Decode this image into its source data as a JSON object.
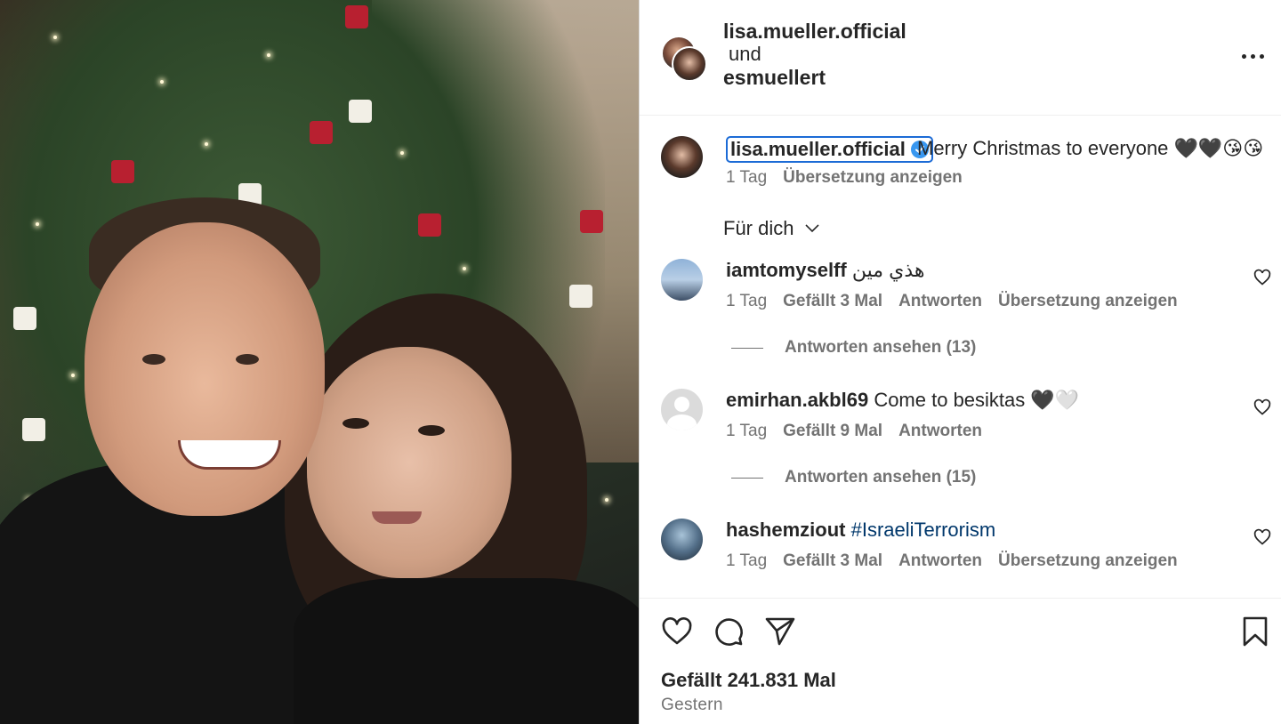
{
  "post_header": {
    "author": "lisa.mueller.official",
    "conjunction": "und",
    "collaborator": "esmuellert",
    "more_icon": "more-horizontal-icon"
  },
  "caption": {
    "username": "lisa.mueller.official",
    "verified_icon": "verified-badge-icon",
    "text": "Merry Christmas to everyone 🖤🖤😘😘",
    "age": "1 Tag",
    "translate": "Übersetzung anzeigen"
  },
  "sort": {
    "label": "Für dich",
    "icon": "chevron-down-icon"
  },
  "comments": [
    {
      "username": "iamtomyselff",
      "text": "هذي مين",
      "age": "1 Tag",
      "likes": "Gefällt 3 Mal",
      "reply": "Antworten",
      "translate": "Übersetzung anzeigen",
      "view_replies": "Antworten ansehen (13)"
    },
    {
      "username": "emirhan.akbl69",
      "text": "Come to besiktas 🖤🤍",
      "age": "1 Tag",
      "likes": "Gefällt 9 Mal",
      "reply": "Antworten",
      "view_replies": "Antworten ansehen (15)"
    },
    {
      "username": "hashemziout",
      "text": "#IsraeliTerrorism",
      "age": "1 Tag",
      "likes": "Gefällt 3 Mal",
      "reply": "Antworten",
      "translate": "Übersetzung anzeigen"
    }
  ],
  "actions": {
    "like_icon": "heart-icon",
    "comment_icon": "comment-icon",
    "share_icon": "send-icon",
    "save_icon": "bookmark-icon"
  },
  "footer": {
    "likes": "Gefällt 241.831 Mal",
    "date": "Gestern"
  },
  "colors": {
    "link": "#00376b",
    "verified": "#3897f0",
    "highlight": "#1c6bd6",
    "secondary_text": "#737373"
  }
}
